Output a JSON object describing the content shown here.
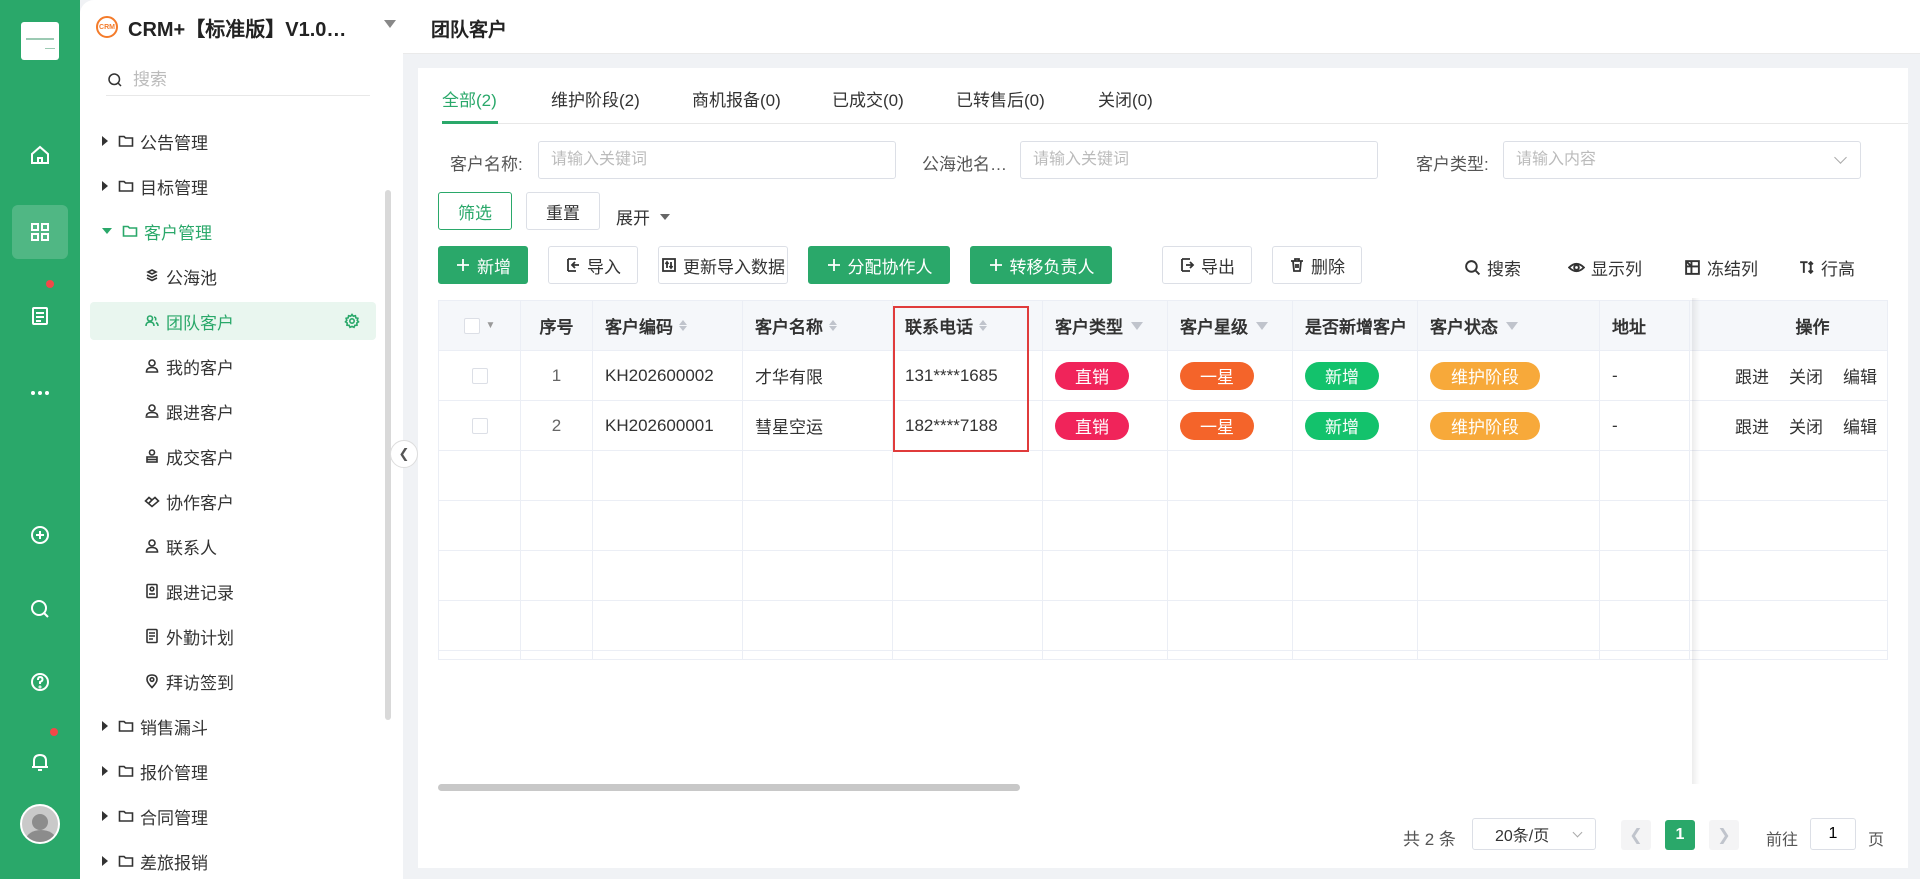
{
  "app": {
    "name": "CRM+【标准版】V1.0…",
    "logo_text": "CRM"
  },
  "menu": {
    "search_placeholder": "搜索",
    "items": [
      {
        "label": "公告管理"
      },
      {
        "label": "目标管理"
      },
      {
        "label": "客户管理"
      },
      {
        "label": "公海池"
      },
      {
        "label": "团队客户"
      },
      {
        "label": "我的客户"
      },
      {
        "label": "跟进客户"
      },
      {
        "label": "成交客户"
      },
      {
        "label": "协作客户"
      },
      {
        "label": "联系人"
      },
      {
        "label": "跟进记录"
      },
      {
        "label": "外勤计划"
      },
      {
        "label": "拜访签到"
      },
      {
        "label": "销售漏斗"
      },
      {
        "label": "报价管理"
      },
      {
        "label": "合同管理"
      },
      {
        "label": "差旅报销"
      }
    ]
  },
  "page": {
    "title": "团队客户"
  },
  "tabs": [
    {
      "label": "全部(2)"
    },
    {
      "label": "维护阶段(2)"
    },
    {
      "label": "商机报备(0)"
    },
    {
      "label": "已成交(0)"
    },
    {
      "label": "已转售后(0)"
    },
    {
      "label": "关闭(0)"
    }
  ],
  "filters": {
    "customer_name_label": "客户名称:",
    "customer_name_placeholder": "请输入关键词",
    "pool_name_label": "公海池名…",
    "pool_name_placeholder": "请输入关键词",
    "customer_type_label": "客户类型:",
    "customer_type_placeholder": "请输入内容",
    "filter_btn": "筛选",
    "reset_btn": "重置",
    "expand": "展开"
  },
  "toolbar": {
    "add": "新增",
    "import": "导入",
    "update_import": "更新导入数据",
    "assign_collaborator": "分配协作人",
    "transfer_owner": "转移负责人",
    "export": "导出",
    "delete": "删除",
    "search": "搜索",
    "columns": "显示列",
    "freeze": "冻结列",
    "row_height": "行高"
  },
  "table": {
    "headers": [
      "序号",
      "客户编码",
      "客户名称",
      "联系电话",
      "客户类型",
      "客户星级",
      "是否新增客户",
      "客户状态",
      "地址",
      "操作"
    ],
    "rows": [
      {
        "index": "1",
        "code": "KH202600002",
        "name": "才华有限",
        "phone": "131****1685",
        "type": "直销",
        "star": "一星",
        "is_new": "新增",
        "status": "维护阶段",
        "address": "-"
      },
      {
        "index": "2",
        "code": "KH202600001",
        "name": "彗星空运",
        "phone": "182****7188",
        "type": "直销",
        "star": "一星",
        "is_new": "新增",
        "status": "维护阶段",
        "address": "-"
      }
    ],
    "actions": [
      "跟进",
      "关闭",
      "编辑"
    ]
  },
  "colors": {
    "brand": "#2aa86a",
    "type_pill": "#f0245a",
    "star_pill": "#f4642a",
    "new_pill": "#13c26c",
    "status_pill": "#f7a93a",
    "highlight": "#e03b3b"
  },
  "pagination": {
    "total": "共 2 条",
    "page_size": "20条/页",
    "current_page": "1",
    "goto_label": "前往",
    "goto_value": "1",
    "page_unit": "页"
  }
}
